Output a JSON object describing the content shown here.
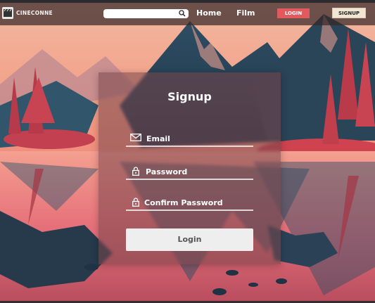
{
  "header": {
    "brand": "CINECONNECT",
    "search": {
      "value": "",
      "placeholder": ""
    },
    "nav": {
      "home": "Home",
      "film": "Film"
    },
    "login_label": "LOGIN",
    "signup_label": "SIGNUP"
  },
  "form": {
    "title": "Signup",
    "email_label": "Email",
    "password_label": "Password",
    "confirm_label": "Confirm Password",
    "submit_label": "Login"
  },
  "colors": {
    "login_accent": "#e35a5e",
    "signup_button": "#f1e6d3",
    "submit_button": "#eeeeee"
  },
  "icons": {
    "logo": "film-clapper-icon",
    "search": "search-icon",
    "email": "envelope-icon",
    "password": "lock-icon",
    "confirm": "lock-icon"
  }
}
